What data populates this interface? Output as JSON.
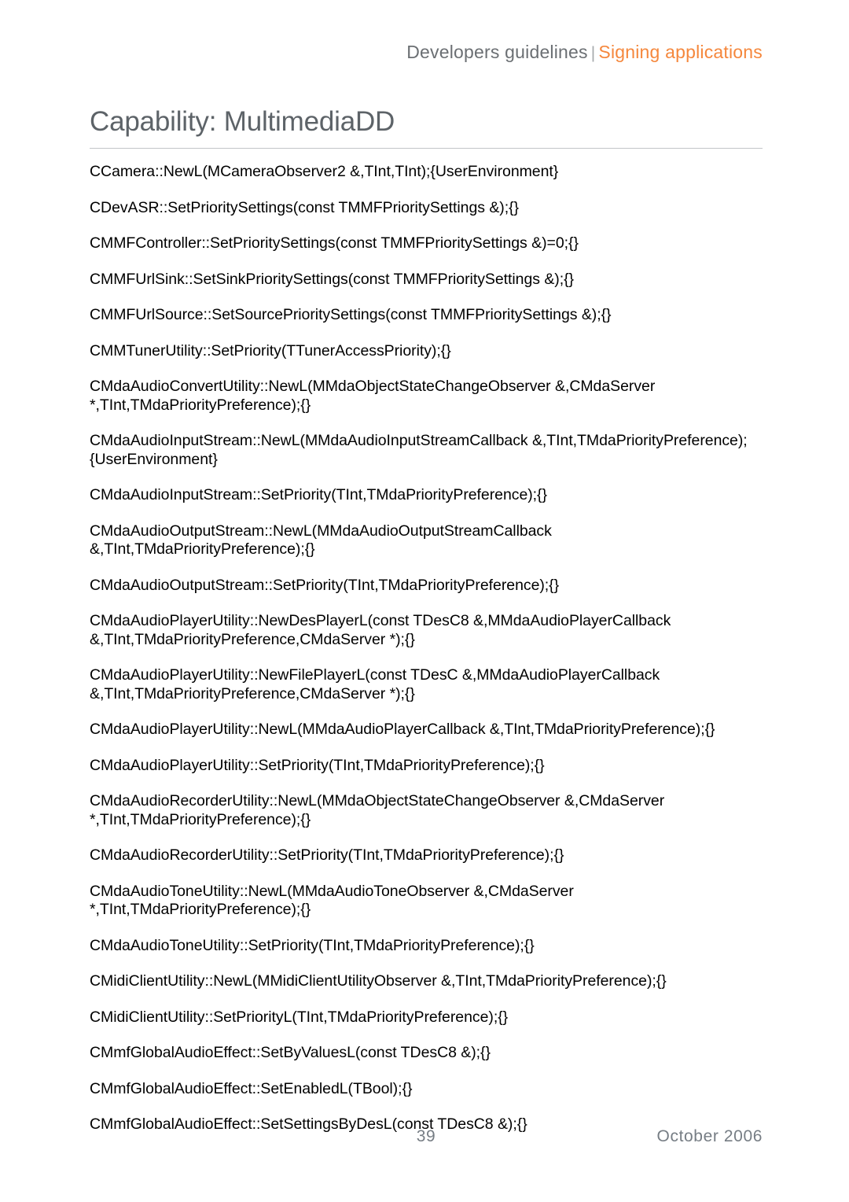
{
  "header": {
    "breadcrumb_main": "Developers guidelines",
    "separator": "|",
    "breadcrumb_accent": "Signing applications",
    "accent_color": "#f5873c",
    "main_color": "#6b6f73"
  },
  "title": {
    "text": "Capability: MultimediaDD",
    "color": "#5d6368",
    "rule_color": "#c2c5c8"
  },
  "body": {
    "entries": [
      "CCamera::NewL(MCameraObserver2 &,TInt,TInt);{UserEnvironment}",
      "CDevASR::SetPrioritySettings(const TMMFPrioritySettings &);{}",
      "CMMFController::SetPrioritySettings(const TMMFPrioritySettings &)=0;{}",
      "CMMFUrlSink::SetSinkPrioritySettings(const TMMFPrioritySettings &);{}",
      "CMMFUrlSource::SetSourcePrioritySettings(const TMMFPrioritySettings &);{}",
      "CMMTunerUtility::SetPriority(TTunerAccessPriority);{}",
      "CMdaAudioConvertUtility::NewL(MMdaObjectStateChangeObserver &,CMdaServer *,TInt,TMdaPriorityPreference);{}",
      "CMdaAudioInputStream::NewL(MMdaAudioInputStreamCallback &,TInt,TMdaPriorityPreference);{UserEnvironment}",
      "CMdaAudioInputStream::SetPriority(TInt,TMdaPriorityPreference);{}",
      "CMdaAudioOutputStream::NewL(MMdaAudioOutputStreamCallback &,TInt,TMdaPriorityPreference);{}",
      "CMdaAudioOutputStream::SetPriority(TInt,TMdaPriorityPreference);{}",
      "CMdaAudioPlayerUtility::NewDesPlayerL(const TDesC8 &,MMdaAudioPlayerCallback &,TInt,TMdaPriorityPreference,CMdaServer *);{}",
      "CMdaAudioPlayerUtility::NewFilePlayerL(const TDesC &,MMdaAudioPlayerCallback &,TInt,TMdaPriorityPreference,CMdaServer *);{}",
      "CMdaAudioPlayerUtility::NewL(MMdaAudioPlayerCallback &,TInt,TMdaPriorityPreference);{}",
      "CMdaAudioPlayerUtility::SetPriority(TInt,TMdaPriorityPreference);{}",
      "CMdaAudioRecorderUtility::NewL(MMdaObjectStateChangeObserver &,CMdaServer *,TInt,TMdaPriorityPreference);{}",
      "CMdaAudioRecorderUtility::SetPriority(TInt,TMdaPriorityPreference);{}",
      "CMdaAudioToneUtility::NewL(MMdaAudioToneObserver &,CMdaServer *,TInt,TMdaPriorityPreference);{}",
      "CMdaAudioToneUtility::SetPriority(TInt,TMdaPriorityPreference);{}",
      "CMidiClientUtility::NewL(MMidiClientUtilityObserver &,TInt,TMdaPriorityPreference);{}",
      "CMidiClientUtility::SetPriorityL(TInt,TMdaPriorityPreference);{}",
      "CMmfGlobalAudioEffect::SetByValuesL(const TDesC8 &);{}",
      "CMmfGlobalAudioEffect::SetEnabledL(TBool);{}",
      "CMmfGlobalAudioEffect::SetSettingsByDesL(const TDesC8 &);{}"
    ]
  },
  "footer": {
    "page_number": "39",
    "date": "October 2006",
    "color": "#767d84"
  }
}
